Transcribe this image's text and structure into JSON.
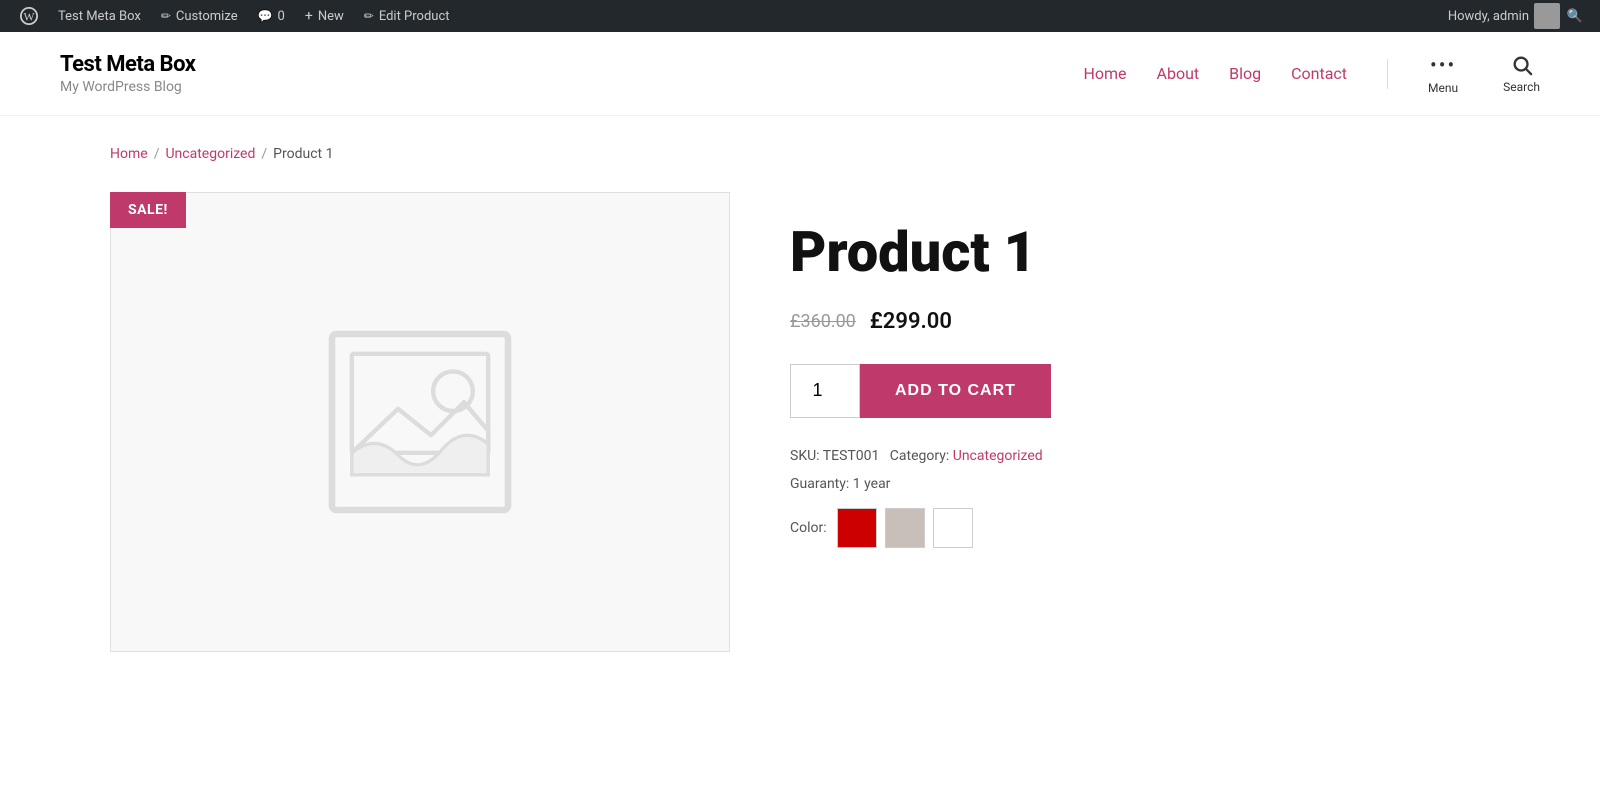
{
  "admin_bar": {
    "wp_icon": "⊞",
    "site_name": "Test Meta Box",
    "customize": "Customize",
    "comments": "0",
    "new": "New",
    "edit_product": "Edit Product",
    "howdy": "Howdy, admin"
  },
  "header": {
    "site_title": "Test Meta Box",
    "tagline": "My WordPress Blog",
    "nav": {
      "home": "Home",
      "about": "About",
      "blog": "Blog",
      "contact": "Contact",
      "menu": "Menu",
      "search": "Search"
    }
  },
  "breadcrumb": {
    "home": "Home",
    "separator1": "/",
    "uncategorized": "Uncategorized",
    "separator2": "/",
    "current": "Product 1"
  },
  "product": {
    "sale_badge": "SALE!",
    "title": "Product 1",
    "price_old": "£360.00",
    "price_new": "£299.00",
    "quantity_default": "1",
    "add_to_cart": "ADD TO CART",
    "sku_label": "SKU:",
    "sku_value": "TEST001",
    "category_label": "Category:",
    "category_value": "Uncategorized",
    "guaranty_label": "Guaranty:",
    "guaranty_value": "1 year",
    "color_label": "Color:",
    "colors": [
      {
        "name": "red",
        "class": "color-red"
      },
      {
        "name": "gray",
        "class": "color-gray"
      },
      {
        "name": "white",
        "class": "color-white"
      }
    ]
  },
  "colors": {
    "accent": "#c0396b",
    "text_dark": "#111111",
    "text_muted": "#999999"
  }
}
